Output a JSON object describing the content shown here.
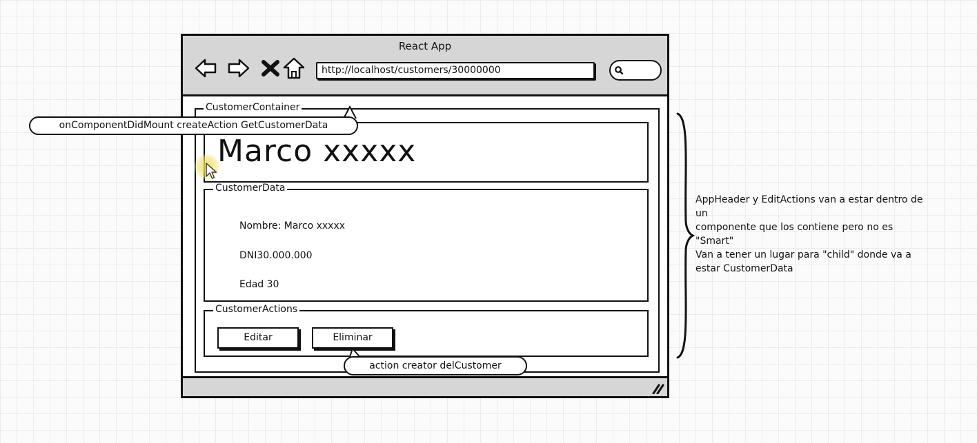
{
  "window": {
    "title": "React App",
    "url": "http://localhost/customers/30000000"
  },
  "icons": {
    "back": "arrow-left-icon",
    "forward": "arrow-right-icon",
    "stop": "close-icon",
    "home": "home-icon",
    "search": "search-icon",
    "resize": "resize-grip-icon",
    "cursor": "mouse-pointer-icon"
  },
  "container": {
    "label": "CustomerContainer"
  },
  "header": {
    "name": "Marco xxxxx"
  },
  "customer_data": {
    "label": "CustomerData",
    "nombre": "Nombre: Marco xxxxx",
    "dni": "DNI30.000.000",
    "edad": "Edad 30"
  },
  "customer_actions": {
    "label": "CustomerActions",
    "edit_label": "Editar",
    "delete_label": "Eliminar"
  },
  "callouts": {
    "mount": "onComponentDidMount createAction GetCustomerData",
    "delete": "action creator delCustomer"
  },
  "side_note": {
    "lines": [
      "AppHeader y EditActions van a estar dentro de",
      "un",
      "componente que los contiene pero no es",
      "\"Smart\"",
      "Van a tener un lugar para \"child\" donde va a",
      "estar CustomerData"
    ]
  }
}
